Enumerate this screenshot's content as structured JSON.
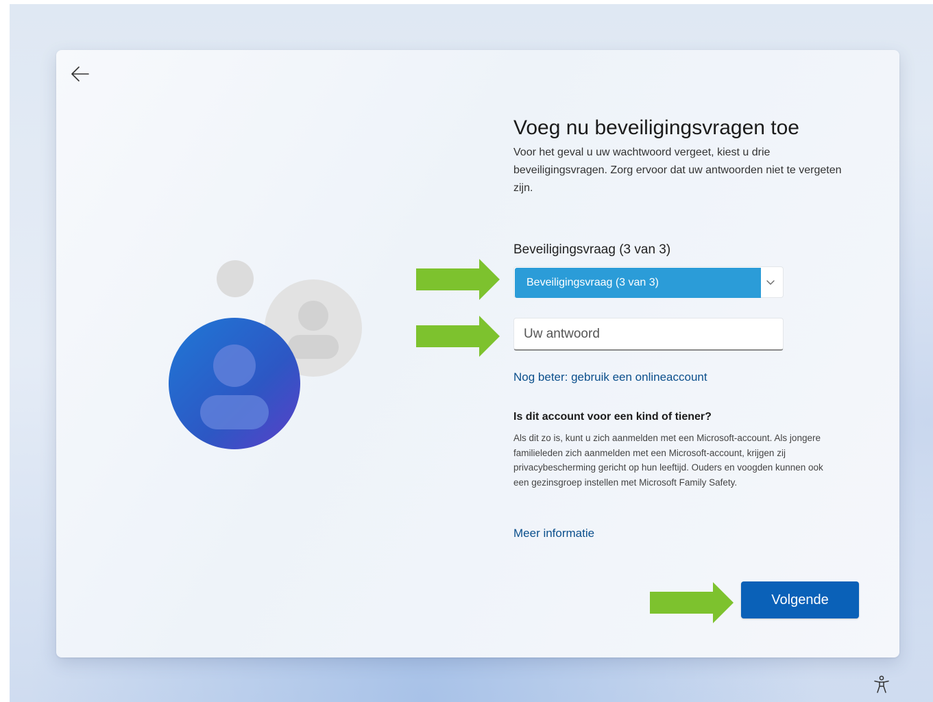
{
  "header": {
    "title": "Voeg nu beveiligingsvragen toe",
    "description": "Voor het geval u uw wachtwoord vergeet, kiest u drie beveiligingsvragen. Zorg ervoor dat uw antwoorden niet te vergeten zijn."
  },
  "question": {
    "label": "Beveiligingsvraag (3 van 3)",
    "selected": "Beveiligingsvraag (3 van 3)"
  },
  "answer": {
    "value": "",
    "placeholder": "Uw antwoord"
  },
  "links": {
    "online_account": "Nog beter: gebruik een onlineaccount",
    "more_info": "Meer informatie"
  },
  "child": {
    "title": "Is dit account voor een kind of tiener?",
    "text": "Als dit zo is, kunt u zich aanmelden met een Microsoft-account. Als jongere familieleden zich aanmelden met een Microsoft-account, krijgen zij privacybescherming gericht op hun leeftijd. Ouders en voogden kunnen ook een gezinsgroep instellen met Microsoft Family Safety."
  },
  "buttons": {
    "next": "Volgende"
  },
  "icons": {
    "back": "back-arrow-icon",
    "chevron": "chevron-down-icon",
    "accessibility": "accessibility-icon",
    "illustration": "user-accounts-illustration"
  },
  "colors": {
    "accent": "#0a61b8",
    "selected_option": "#2b9cd8",
    "annotation_arrow": "#7dc22e",
    "link": "#0b4f8c"
  }
}
